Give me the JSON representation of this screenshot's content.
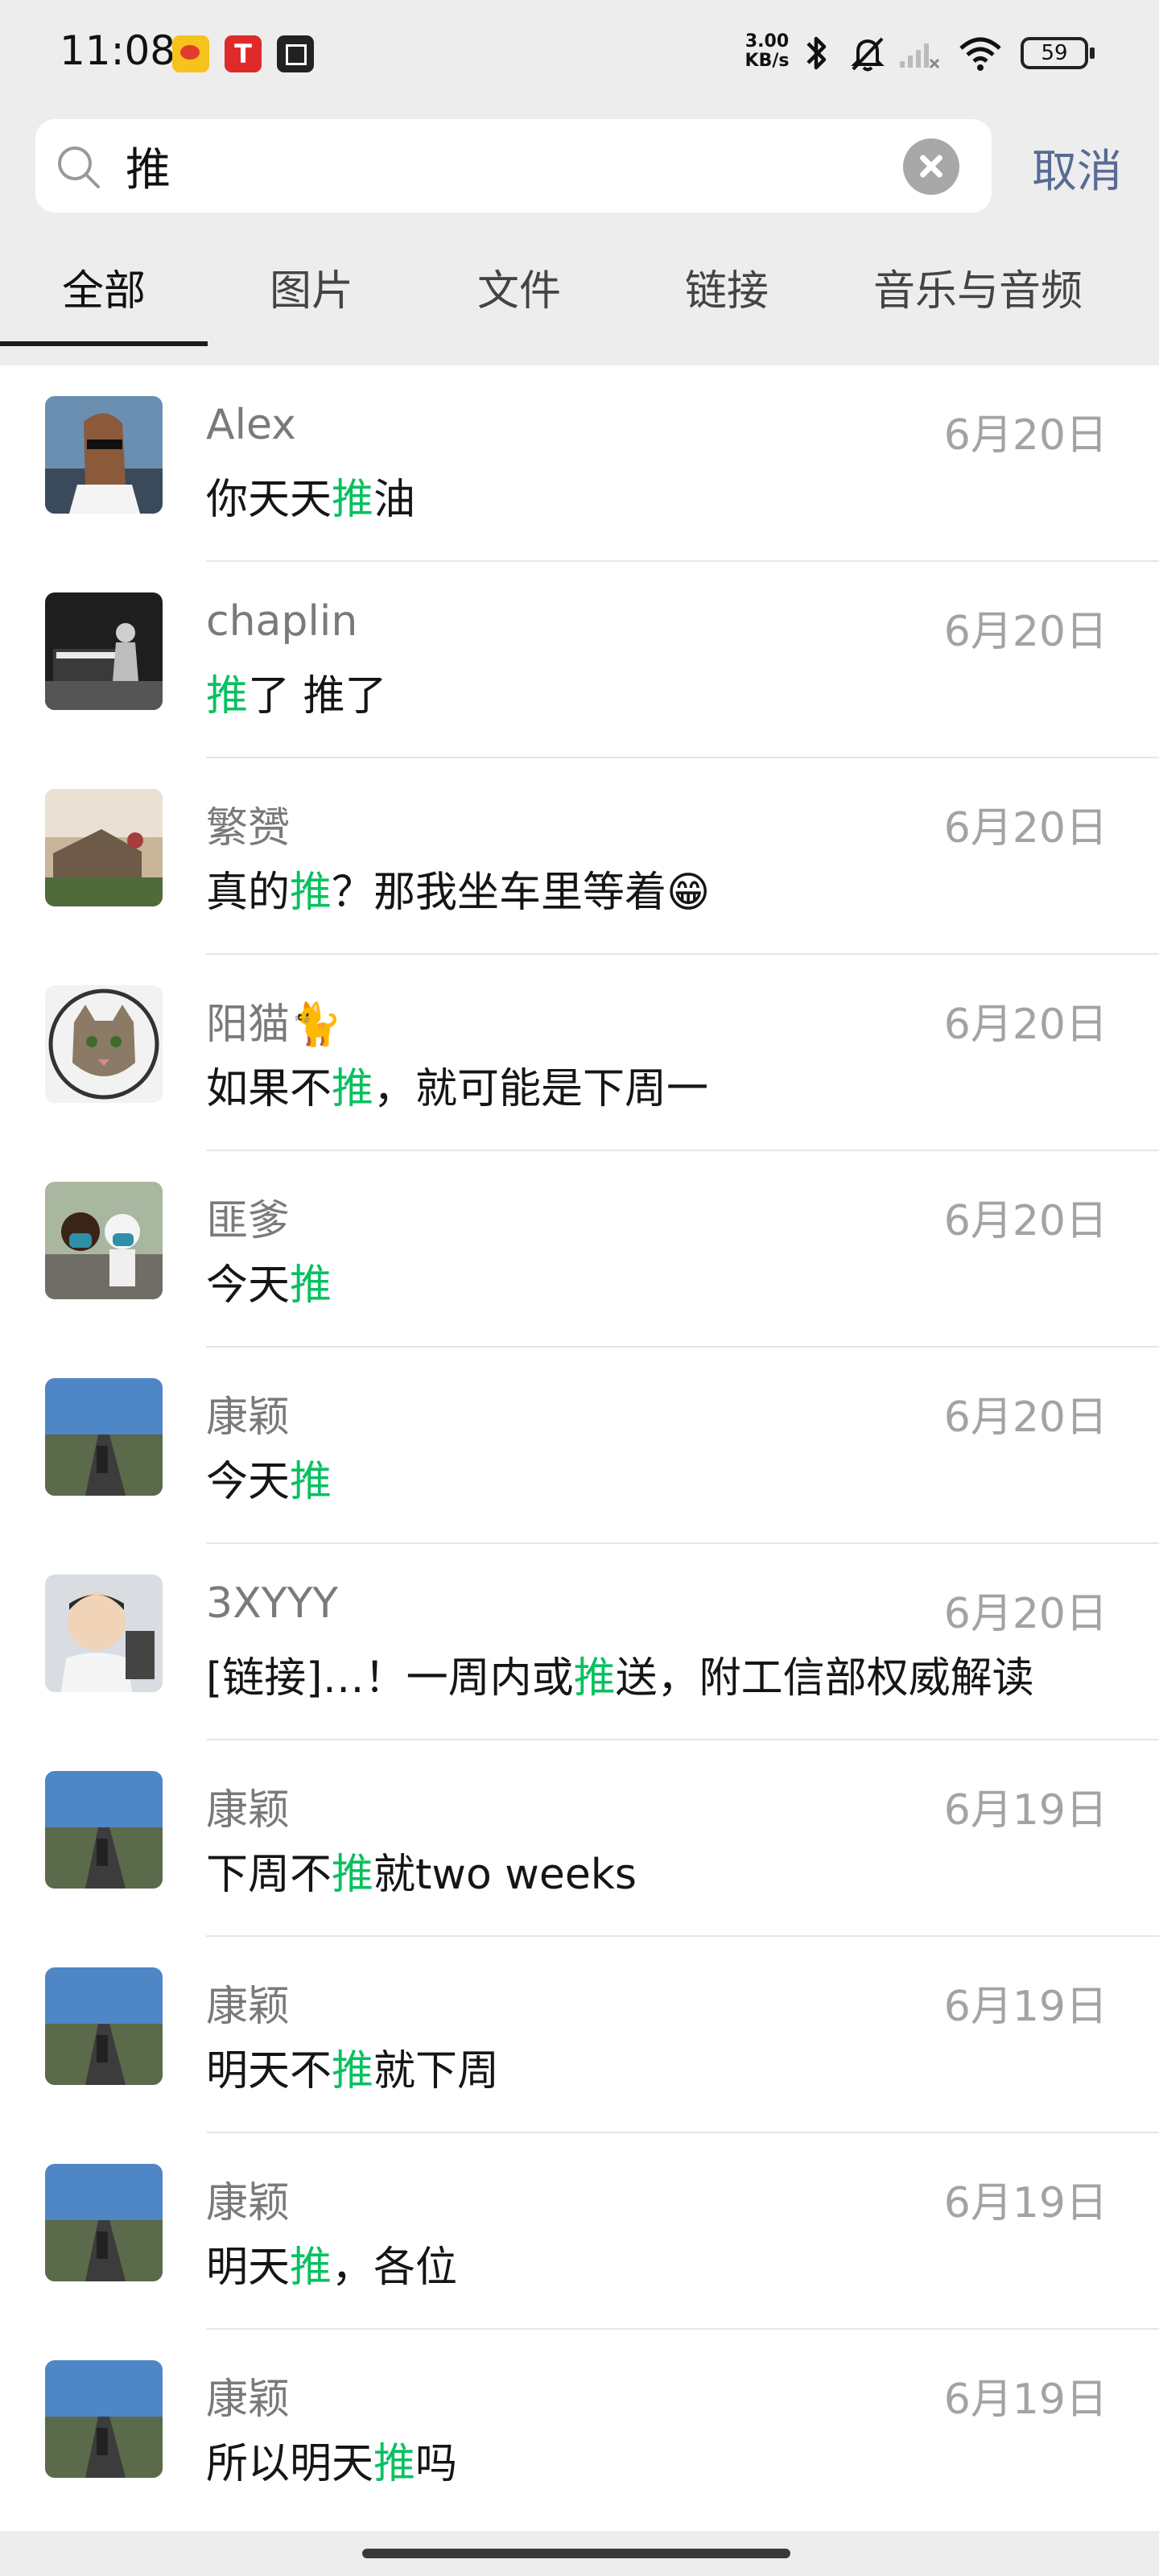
{
  "status_bar": {
    "time": "11:08",
    "net_speed_top": "3.00",
    "net_speed_bottom": "KB/s",
    "battery": "59"
  },
  "search": {
    "query": "推",
    "cancel_label": "取消"
  },
  "tabs": [
    "全部",
    "图片",
    "文件",
    "链接",
    "音乐与音频"
  ],
  "active_tab": "全部",
  "colors": {
    "highlight": "#07c160",
    "cancel": "#576b95",
    "background": "#ededed"
  },
  "results": [
    {
      "name": "Alex",
      "date": "6月20日",
      "msg_before": "你天天",
      "msg_match": "推",
      "msg_after": "油",
      "avatar": "horse-cartoon-avatar"
    },
    {
      "name": "chaplin",
      "date": "6月20日",
      "msg_before": "",
      "msg_match": "推",
      "msg_after": "了 推了",
      "avatar": "piano-photo-avatar"
    },
    {
      "name": "繁赟",
      "date": "6月20日",
      "msg_before": "真的",
      "msg_match": "推",
      "msg_after": "？那我坐车里等着😁",
      "avatar": "outdoor-photo-avatar"
    },
    {
      "name": "阳猫🐈",
      "date": "6月20日",
      "msg_before": "如果不",
      "msg_match": "推",
      "msg_after": "，就可能是下周一",
      "avatar": "cat-avatar"
    },
    {
      "name": "匪爹",
      "date": "6月20日",
      "msg_before": "今天",
      "msg_match": "推",
      "msg_after": "",
      "avatar": "dogs-photo-avatar"
    },
    {
      "name": "康颖",
      "date": "6月20日",
      "msg_before": "今天",
      "msg_match": "推",
      "msg_after": "",
      "avatar": "road-photo-avatar"
    },
    {
      "name": "3XYYY",
      "date": "6月20日",
      "msg_before": "[链接]…！一周内或",
      "msg_match": "推",
      "msg_after": "送，附工信部权威解读",
      "avatar": "child-photo-avatar"
    },
    {
      "name": "康颖",
      "date": "6月19日",
      "msg_before": "下周不",
      "msg_match": "推",
      "msg_after": "就two weeks",
      "avatar": "road-photo-avatar"
    },
    {
      "name": "康颖",
      "date": "6月19日",
      "msg_before": "明天不",
      "msg_match": "推",
      "msg_after": "就下周",
      "avatar": "road-photo-avatar"
    },
    {
      "name": "康颖",
      "date": "6月19日",
      "msg_before": "明天",
      "msg_match": "推",
      "msg_after": "，各位",
      "avatar": "road-photo-avatar"
    },
    {
      "name": "康颖",
      "date": "6月19日",
      "msg_before": "所以明天",
      "msg_match": "推",
      "msg_after": "吗",
      "avatar": "road-photo-avatar"
    }
  ]
}
